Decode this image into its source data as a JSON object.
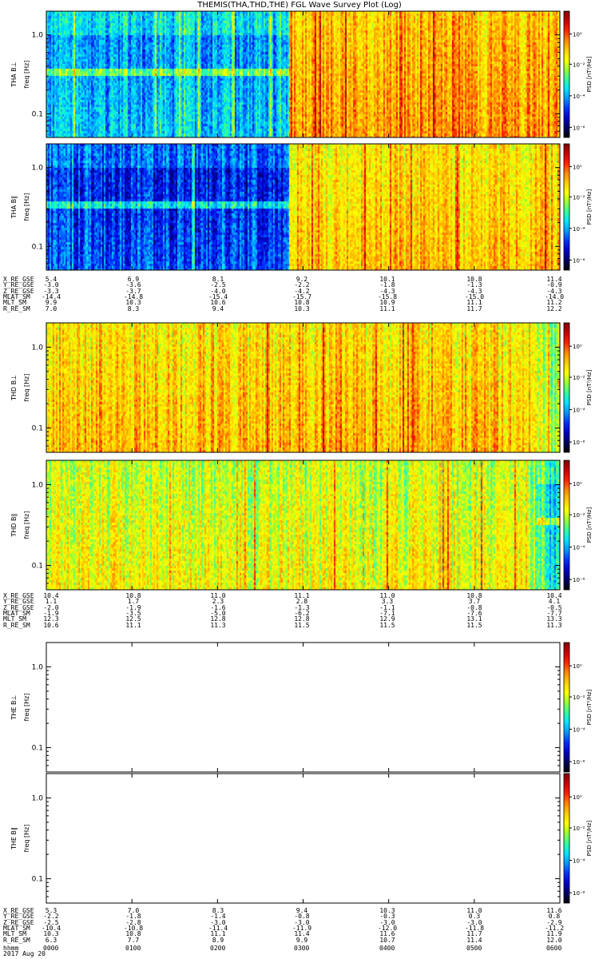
{
  "title": "THEMIS(THA,THD,THE) FGL Wave Survey Plot (Log)",
  "colors": {
    "colormap": [
      "#000000",
      "#000066",
      "#0000cc",
      "#0033ff",
      "#0099ff",
      "#00e5ff",
      "#33ff99",
      "#99ff33",
      "#ffff00",
      "#ffcc00",
      "#ff8800",
      "#ff2200",
      "#cc0000",
      "#800000"
    ]
  },
  "chart_data": [
    {
      "type": "heatmap",
      "ylabel": "THA B⊥",
      "yunit": "freq [Hz]",
      "yticks": [
        "1.0",
        "0.1"
      ],
      "ylim": [
        0.05,
        2.0
      ],
      "scale": "log",
      "colorbar": {
        "label": "PSD [nT²/Hz]",
        "ticks": [
          "10⁰",
          "10⁻²",
          "10⁻⁴",
          "10⁻⁶"
        ]
      },
      "pattern": {
        "segments": [
          {
            "from": 0.0,
            "to": 0.47,
            "level": 0.32
          },
          {
            "from": 0.47,
            "to": 1.0,
            "level": 0.72
          }
        ],
        "tail_drop": 0.0
      }
    },
    {
      "type": "heatmap",
      "ylabel": "THA B∥",
      "yunit": "freq [Hz]",
      "yticks": [
        "1.0",
        "0.1"
      ],
      "ylim": [
        0.05,
        2.0
      ],
      "scale": "log",
      "colorbar": {
        "label": "PSD [nT²/Hz]",
        "ticks": [
          "10⁰",
          "10⁻²",
          "10⁻⁴",
          "10⁻⁶"
        ]
      },
      "pattern": {
        "segments": [
          {
            "from": 0.0,
            "to": 0.47,
            "level": 0.22
          },
          {
            "from": 0.47,
            "to": 1.0,
            "level": 0.68
          }
        ],
        "tail_drop": 0.0
      }
    },
    {
      "type": "heatmap",
      "ylabel": "THD B⊥",
      "yunit": "freq [Hz]",
      "yticks": [
        "1.0",
        "0.1"
      ],
      "ylim": [
        0.05,
        2.0
      ],
      "scale": "log",
      "colorbar": {
        "label": "PSD [nT²/Hz]",
        "ticks": [
          "10⁰",
          "10⁻²",
          "10⁻⁴",
          "10⁻⁶"
        ]
      },
      "pattern": {
        "segments": [
          {
            "from": 0.0,
            "to": 1.0,
            "level": 0.68
          }
        ],
        "tail_drop": 0.2
      }
    },
    {
      "type": "heatmap",
      "ylabel": "THD B∥",
      "yunit": "freq [Hz]",
      "yticks": [
        "1.0",
        "0.1"
      ],
      "ylim": [
        0.05,
        2.0
      ],
      "scale": "log",
      "colorbar": {
        "label": "PSD [nT²/Hz]",
        "ticks": [
          "10⁰",
          "10⁻²",
          "10⁻⁴",
          "10⁻⁶"
        ]
      },
      "pattern": {
        "segments": [
          {
            "from": 0.0,
            "to": 1.0,
            "level": 0.6
          }
        ],
        "tail_drop": 0.3
      }
    },
    {
      "type": "heatmap",
      "ylabel": "THE B⊥",
      "yunit": "freq [Hz]",
      "yticks": [
        "1.0",
        "0.1"
      ],
      "ylim": [
        0.05,
        2.0
      ],
      "scale": "log",
      "colorbar": {
        "label": "PSD [nT²/Hz]",
        "ticks": [
          "10⁰",
          "10⁻²",
          "10⁻⁴",
          "10⁻⁶"
        ]
      },
      "pattern": {
        "segments": [],
        "tail_drop": 0.0
      }
    },
    {
      "type": "heatmap",
      "ylabel": "THE B∥",
      "yunit": "freq [Hz]",
      "yticks": [
        "1.0",
        "0.1"
      ],
      "ylim": [
        0.05,
        2.0
      ],
      "scale": "log",
      "colorbar": {
        "label": "PSD [nT²/Hz]",
        "ticks": [
          "10⁰",
          "10⁻²",
          "10⁻⁴",
          "10⁻⁶"
        ]
      },
      "pattern": {
        "segments": [],
        "tail_drop": 0.0
      }
    }
  ],
  "ephemeris": [
    {
      "labels": [
        "X_RE_GSE",
        "Y_RE_GSE",
        "Z_RE_GSE",
        "MLAT_SM",
        "MLT_SM",
        "R_RE_SM"
      ],
      "columns": [
        [
          "5.4",
          "-3.0",
          "-3.3",
          "-14.4",
          "9.9",
          "7.0"
        ],
        [
          "6.9",
          "-3.6",
          "-3.7",
          "-14.8",
          "10.3",
          "8.3"
        ],
        [
          "8.1",
          "-2.5",
          "-4.0",
          "-15.4",
          "10.6",
          "9.4"
        ],
        [
          "9.2",
          "-2.2",
          "-4.2",
          "-15.7",
          "10.8",
          "10.3"
        ],
        [
          "10.1",
          "-1.8",
          "-4.3",
          "-15.8",
          "10.9",
          "11.1"
        ],
        [
          "10.8",
          "-1.3",
          "-4.3",
          "-15.0",
          "11.1",
          "11.7"
        ],
        [
          "11.4",
          "-0.9",
          "-4.3",
          "-14.0",
          "11.2",
          "12.2"
        ]
      ]
    },
    {
      "labels": [
        "X_RE_GSE",
        "Y_RE_GSE",
        "Z_RE_GSE",
        "MLAT_SM",
        "MLT_SM",
        "R_RE_SM"
      ],
      "columns": [
        [
          "10.4",
          "1.1",
          "-2.0",
          "-1.9",
          "12.3",
          "10.6"
        ],
        [
          "10.8",
          "1.7",
          "-1.9",
          "-3.5",
          "12.5",
          "11.1"
        ],
        [
          "11.0",
          "2.3",
          "-1.6",
          "-5.0",
          "12.8",
          "11.3"
        ],
        [
          "11.1",
          "2.8",
          "-1.3",
          "-6.2",
          "12.8",
          "11.5"
        ],
        [
          "11.0",
          "3.3",
          "-1.1",
          "-7.1",
          "12.9",
          "11.5"
        ],
        [
          "10.8",
          "3.7",
          "-0.8",
          "-7.6",
          "13.1",
          "11.5"
        ],
        [
          "10.4",
          "4.1",
          "-0.5",
          "-7.7",
          "13.3",
          "11.3"
        ]
      ]
    },
    {
      "labels": [
        "X_RE_GSE",
        "Y_RE_GSE",
        "Z_RE_GSE",
        "MLAT_SM",
        "MLT_SM",
        "R_RE_SM"
      ],
      "columns": [
        [
          "5.3",
          "-2.2",
          "-2.5",
          "-10.4",
          "10.3",
          "6.3"
        ],
        [
          "7.0",
          "-1.8",
          "-2.8",
          "-10.8",
          "10.8",
          "7.7"
        ],
        [
          "8.3",
          "-1.4",
          "-3.0",
          "-11.4",
          "11.1",
          "8.9"
        ],
        [
          "9.4",
          "-0.8",
          "-3.0",
          "-11.9",
          "11.4",
          "9.9"
        ],
        [
          "10.3",
          "-0.3",
          "-3.0",
          "-12.0",
          "11.6",
          "10.7"
        ],
        [
          "11.0",
          "0.3",
          "-3.0",
          "-11.8",
          "11.7",
          "11.4"
        ],
        [
          "11.6",
          "0.8",
          "-2.9",
          "-11.2",
          "11.9",
          "12.0"
        ]
      ]
    }
  ],
  "time_axis": {
    "label": "hhmm",
    "date": "2017 Aug 20",
    "ticks": [
      "0000",
      "0100",
      "0200",
      "0300",
      "0400",
      "0500",
      "0600"
    ]
  }
}
